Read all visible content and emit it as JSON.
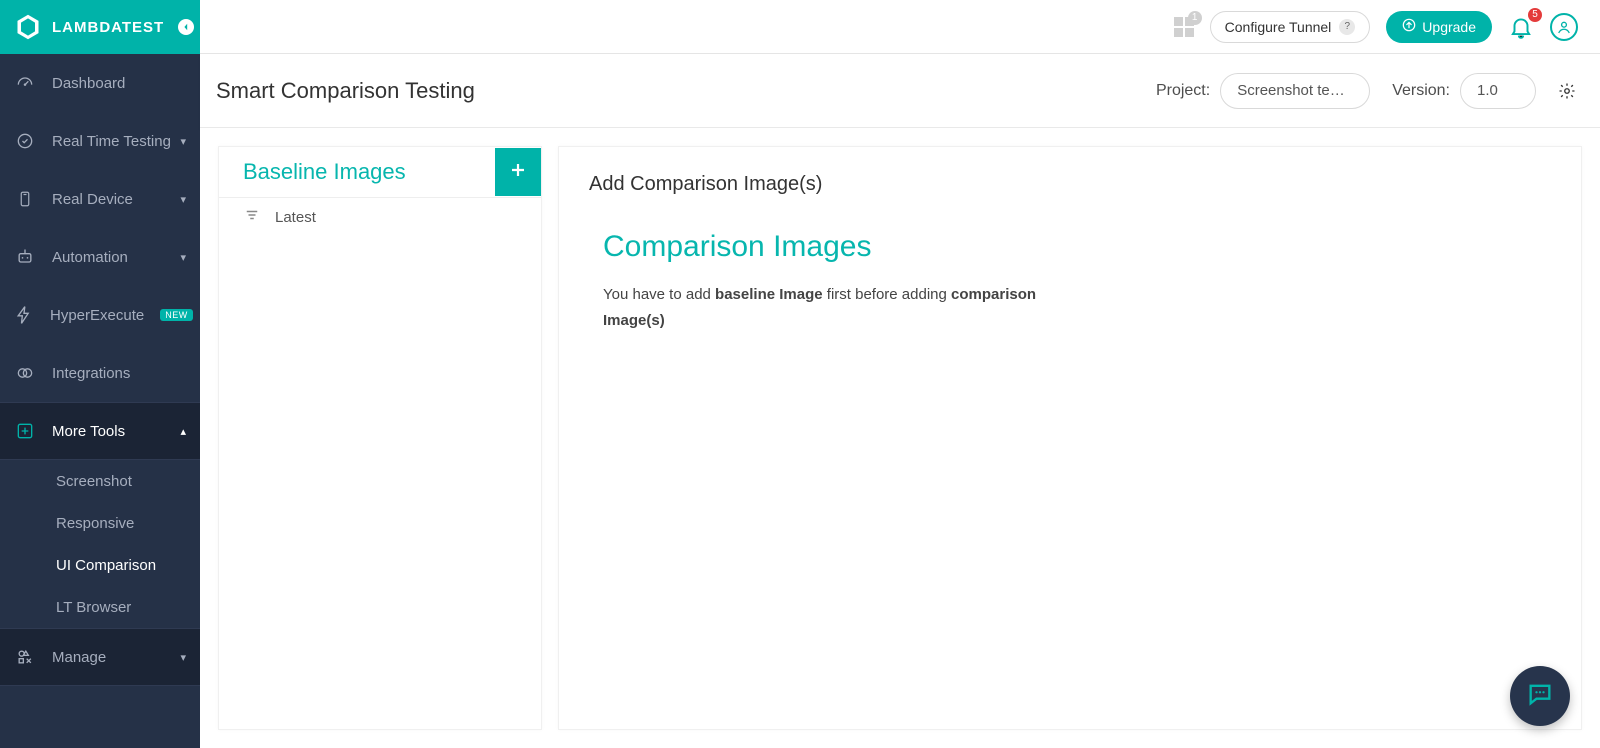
{
  "brand": {
    "name": "LAMBDATEST"
  },
  "top": {
    "apps_badge": "1",
    "tunnel_label": "Configure Tunnel",
    "upgrade_label": "Upgrade",
    "notifications_badge": "5"
  },
  "nav": {
    "dashboard": "Dashboard",
    "realtime": "Real Time Testing",
    "realdevice": "Real Device",
    "automation": "Automation",
    "hyperexecute": "HyperExecute",
    "hyperexecute_badge": "NEW",
    "integrations": "Integrations",
    "moretools": "More Tools",
    "manage": "Manage",
    "sub": {
      "screenshot": "Screenshot",
      "responsive": "Responsive",
      "uicomparison": "UI Comparison",
      "ltbrowser": "LT Browser"
    }
  },
  "page": {
    "title": "Smart Comparison Testing",
    "project_label": "Project:",
    "project_value": "Screenshot te…",
    "version_label": "Version:",
    "version_value": "1.0"
  },
  "baseline": {
    "title": "Baseline Images",
    "item0": "Latest"
  },
  "comparison": {
    "header": "Add Comparison Image(s)",
    "title": "Comparison Images",
    "help_pre": "You have to add ",
    "help_b1": "baseline Image",
    "help_mid": " first before adding ",
    "help_b2": "comparison Image(s)"
  }
}
